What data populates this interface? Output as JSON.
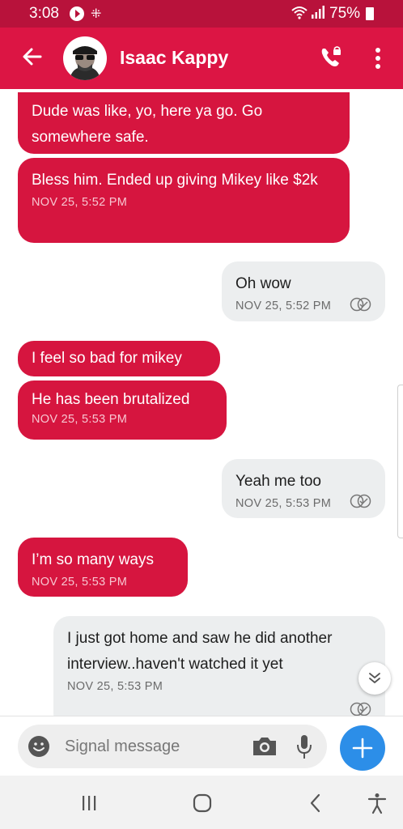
{
  "status_bar": {
    "time": "3:08",
    "battery": "75%",
    "icons": [
      "play-icon",
      "grid-icon",
      "wifi-icon",
      "signal-icon",
      "battery-icon"
    ]
  },
  "header": {
    "contact_name": "Isaac Kappy",
    "icons": [
      "back-arrow-icon",
      "avatar",
      "phone-call-icon",
      "more-vert-icon"
    ]
  },
  "messages": [
    {
      "dir": "in",
      "text": "Dude was like, yo, here ya go. Go somewhere safe.",
      "time": ""
    },
    {
      "dir": "in",
      "text": "Bless him. Ended up giving Mikey like $2k",
      "time": "NOV 25, 5:52 PM"
    },
    {
      "dir": "out",
      "text": "Oh wow",
      "time": "NOV 25, 5:52 PM"
    },
    {
      "dir": "in",
      "text": "I feel so bad for mikey",
      "time": ""
    },
    {
      "dir": "in",
      "text": "He has been brutalized",
      "time": "NOV 25, 5:53 PM"
    },
    {
      "dir": "out",
      "text": "Yeah me too",
      "time": "NOV 25, 5:53 PM"
    },
    {
      "dir": "in",
      "text": "I’m so many ways",
      "time": "NOV 25, 5:53 PM"
    },
    {
      "dir": "out",
      "text": "I just got home and saw he did another interview..haven't watched it yet",
      "time": "NOV 25, 5:53 PM"
    }
  ],
  "composer": {
    "placeholder": "Signal message",
    "value": ""
  },
  "colors": {
    "status_bar": "#b8123b",
    "app_bar": "#dc1544",
    "incoming_bubble": "#d6153f",
    "outgoing_bubble": "#eceeef",
    "send_button": "#2c8ee8"
  }
}
